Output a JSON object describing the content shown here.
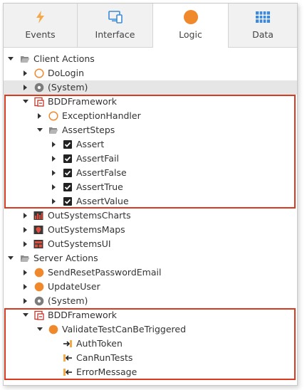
{
  "tabs": [
    {
      "label": "Events",
      "icon": "lightning-icon"
    },
    {
      "label": "Interface",
      "icon": "devices-icon"
    },
    {
      "label": "Logic",
      "icon": "orange-circle-icon",
      "active": true
    },
    {
      "label": "Data",
      "icon": "grid-icon"
    }
  ],
  "tree": {
    "client_actions": {
      "label": "Client Actions",
      "items": {
        "dologin": "DoLogin",
        "system": "(System)",
        "bdd": "BDDFramework",
        "exception": "ExceptionHandler",
        "assertsteps": "AssertSteps",
        "assert": "Assert",
        "assertfail": "AssertFail",
        "assertfalse": "AssertFalse",
        "asserttrue": "AssertTrue",
        "assertvalue": "AssertValue",
        "charts": "OutSystemsCharts",
        "maps": "OutSystemsMaps",
        "ui": "OutSystemsUI"
      }
    },
    "server_actions": {
      "label": "Server Actions",
      "items": {
        "sendreset": "SendResetPasswordEmail",
        "updateuser": "UpdateUser",
        "system": "(System)",
        "bdd": "BDDFramework",
        "validate": "ValidateTestCanBeTriggered",
        "authtoken": "AuthToken",
        "canruntests": "CanRunTests",
        "errormessage": "ErrorMessage"
      }
    }
  },
  "colors": {
    "highlight": "#d73a1e",
    "orange": "#f0892c",
    "bolt": "#f4a949",
    "blue": "#3e8ad8"
  }
}
